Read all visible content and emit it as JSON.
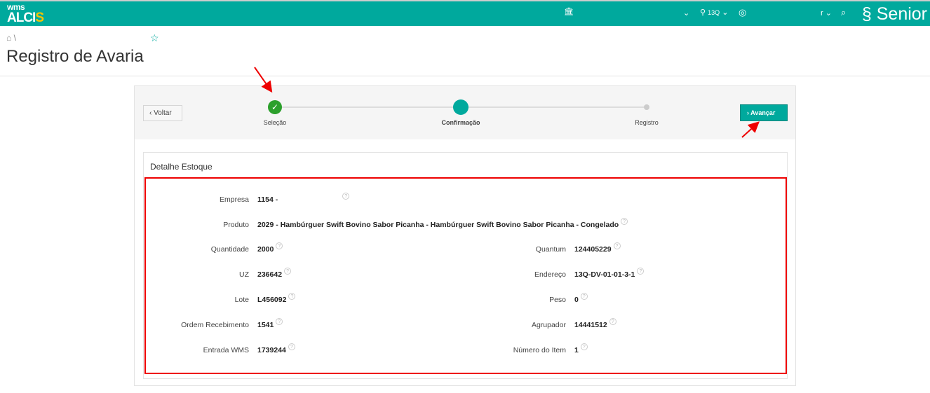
{
  "header": {
    "logo_top": "wms",
    "logo_main": "ALCI",
    "logo_accent": "S",
    "location": "13Q",
    "user": "r",
    "brand": "Senior"
  },
  "breadcrumb": {
    "separator": "\\"
  },
  "page_title": "Registro de Avaria",
  "wizard": {
    "back_label": "Voltar",
    "next_label": "Avançar",
    "steps": [
      {
        "label": "Seleção",
        "state": "done"
      },
      {
        "label": "Confirmação",
        "state": "active"
      },
      {
        "label": "Registro",
        "state": "pending"
      }
    ]
  },
  "panel": {
    "title": "Detalhe Estoque",
    "left": [
      {
        "label": "Quantidade",
        "value": "2000"
      },
      {
        "label": "UZ",
        "value": "236642"
      },
      {
        "label": "Lote",
        "value": "L456092"
      },
      {
        "label": "Ordem Recebimento",
        "value": "1541"
      },
      {
        "label": "Entrada WMS",
        "value": "1739244"
      }
    ],
    "right": [
      {
        "label": "Quantum",
        "value": "124405229"
      },
      {
        "label": "Endereço",
        "value": "13Q-DV-01-01-3-1"
      },
      {
        "label": "Peso",
        "value": "0"
      },
      {
        "label": "Agrupador",
        "value": "14441512"
      },
      {
        "label": "Número do Item",
        "value": "1"
      }
    ],
    "empresa": {
      "label": "Empresa",
      "value": "1154 -"
    },
    "produto": {
      "label": "Produto",
      "value": "2029 - Hambúrguer Swift Bovino Sabor Picanha - Hambúrguer Swift Bovino Sabor Picanha - Congelado"
    }
  },
  "colors": {
    "accent": "#00a99d",
    "done": "#2ca02c",
    "highlight": "#e00000"
  }
}
